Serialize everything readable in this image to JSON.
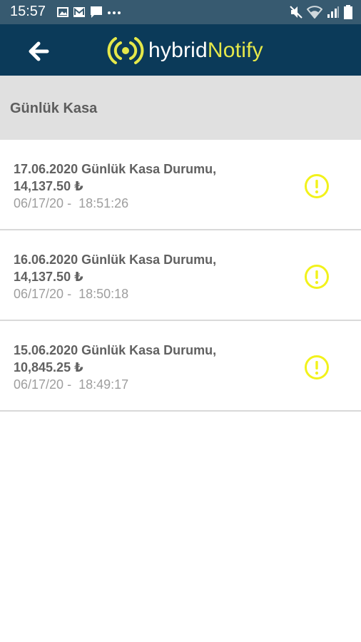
{
  "status_bar": {
    "time": "15:57",
    "left_icons": [
      "image-icon",
      "gallery-icon",
      "message-icon",
      "more-icon"
    ],
    "right_icons": [
      "mute-icon",
      "wifi-icon",
      "signal-icon",
      "battery-icon"
    ]
  },
  "app_bar": {
    "logo_part1": "hybrid",
    "logo_part2": "Notify",
    "colors": {
      "background": "#0b3a59",
      "accent": "#e5e84a"
    }
  },
  "section": {
    "title": "Günlük Kasa"
  },
  "notifications": [
    {
      "title": "17.06.2020 Günlük Kasa Durumu, 14,137.50 ₺",
      "time": "06/17/20 -  18:51:26",
      "icon": "warning-icon"
    },
    {
      "title": "16.06.2020 Günlük Kasa Durumu, 14,137.50 ₺",
      "time": "06/17/20 -  18:50:18",
      "icon": "warning-icon"
    },
    {
      "title": "15.06.2020 Günlük Kasa Durumu, 10,845.25 ₺",
      "time": "06/17/20 -  18:49:17",
      "icon": "warning-icon"
    }
  ]
}
